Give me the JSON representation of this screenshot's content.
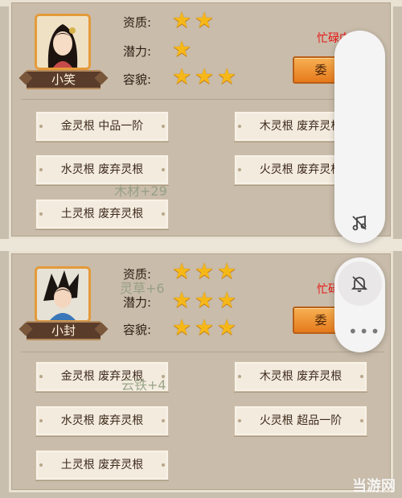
{
  "cards": [
    {
      "name": "小笑",
      "stats": [
        {
          "label": "资质:",
          "stars": 2
        },
        {
          "label": "潜力:",
          "stars": 1
        },
        {
          "label": "容貌:",
          "stars": 3
        }
      ],
      "status": "忙碌中",
      "action_label": "委",
      "roots": [
        "金灵根 中品一阶",
        "木灵根 废弃灵根",
        "水灵根 废弃灵根",
        "火灵根 废弃灵根",
        "土灵根 废弃灵根"
      ],
      "floating": [
        "木材+29"
      ]
    },
    {
      "name": "小封",
      "stats": [
        {
          "label": "资质:",
          "stars": 3
        },
        {
          "label": "潜力:",
          "stars": 3
        },
        {
          "label": "容貌:",
          "stars": 3
        }
      ],
      "status": "忙碌",
      "action_label": "委",
      "roots": [
        "金灵根 废弃灵根",
        "木灵根 废弃灵根",
        "水灵根 废弃灵根",
        "火灵根 超品一阶",
        "土灵根 废弃灵根"
      ],
      "floating": [
        "灵草+6",
        "云铁+4"
      ]
    }
  ],
  "overlay": {
    "icons": [
      "music-off-icon",
      "bell-off-icon",
      "more-icon"
    ],
    "more_glyph": "•••"
  },
  "watermark": "当游网",
  "colors": {
    "status": "#e81414",
    "star": "#f6b818",
    "action": "#e57a1c"
  }
}
